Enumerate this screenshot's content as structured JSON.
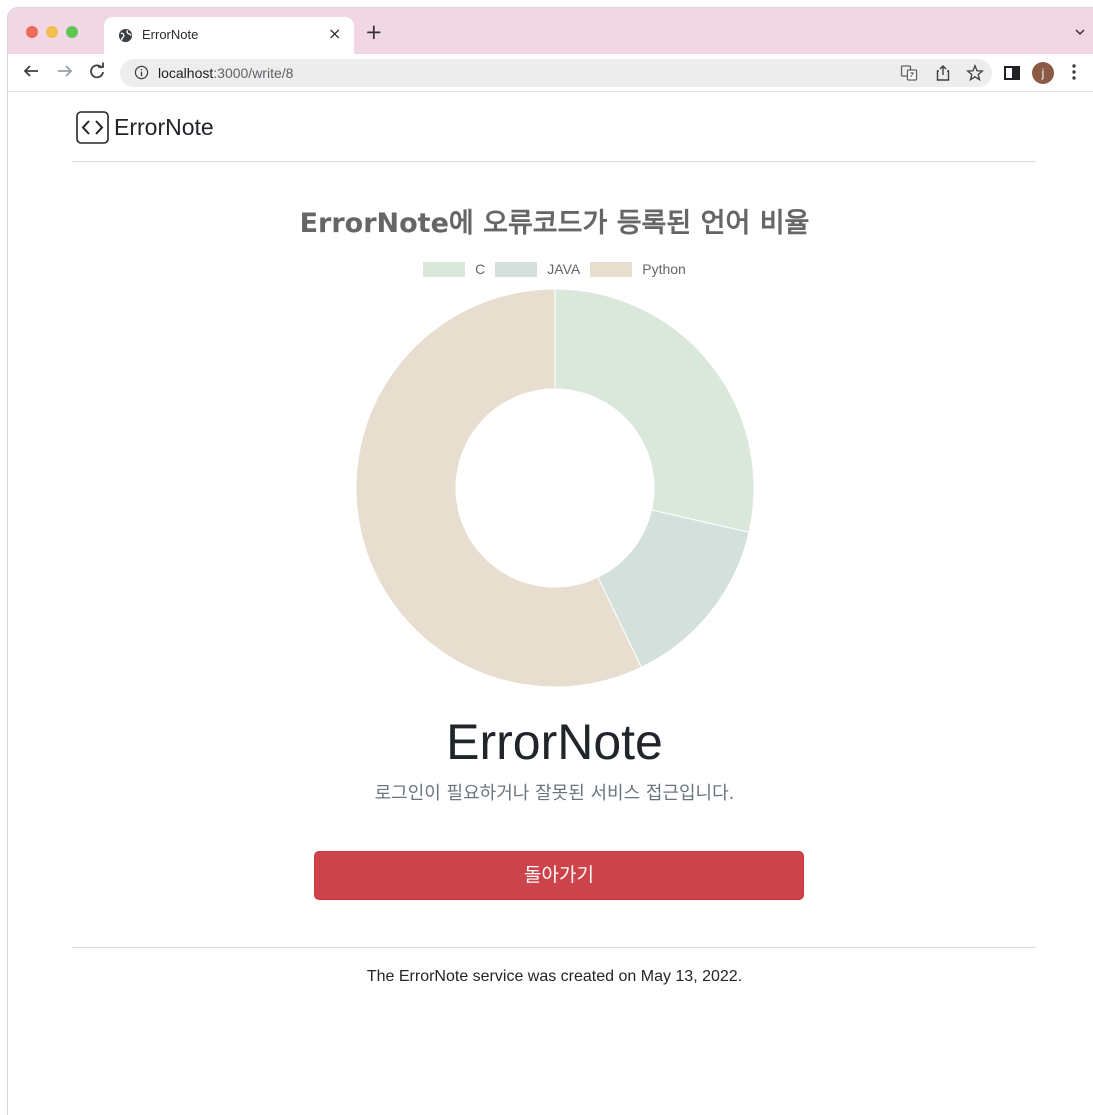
{
  "browser": {
    "tab_title": "ErrorNote",
    "new_tab_symbol": "+",
    "close_symbol": "×",
    "url_host": "localhost",
    "url_rest": ":3000/write/8",
    "avatar_initial": "j",
    "colors": {
      "tab_strip": "#f1d7e3",
      "close": "#ed6a5e",
      "minimize": "#f4bf4f",
      "maximize": "#61c554"
    }
  },
  "navbar": {
    "brand": "ErrorNote"
  },
  "chart_data": {
    "type": "doughnut",
    "title": "ErrorNote에 오류코드가 등록된 언어 비율",
    "legend_position": "top",
    "categories": [
      "C",
      "JAVA",
      "Python"
    ],
    "values": [
      4,
      2,
      8
    ],
    "colors": [
      "#d9e8da",
      "#d3e0dc",
      "#e8ded0"
    ]
  },
  "main": {
    "title": "ErrorNote",
    "subtitle": "로그인이 필요하거나 잘못된 서비스 접근입니다.",
    "back_button": "돌아가기",
    "button_color": "#cc434a"
  },
  "footer": {
    "text": "The ErrorNote service was created on May 13, 2022."
  }
}
